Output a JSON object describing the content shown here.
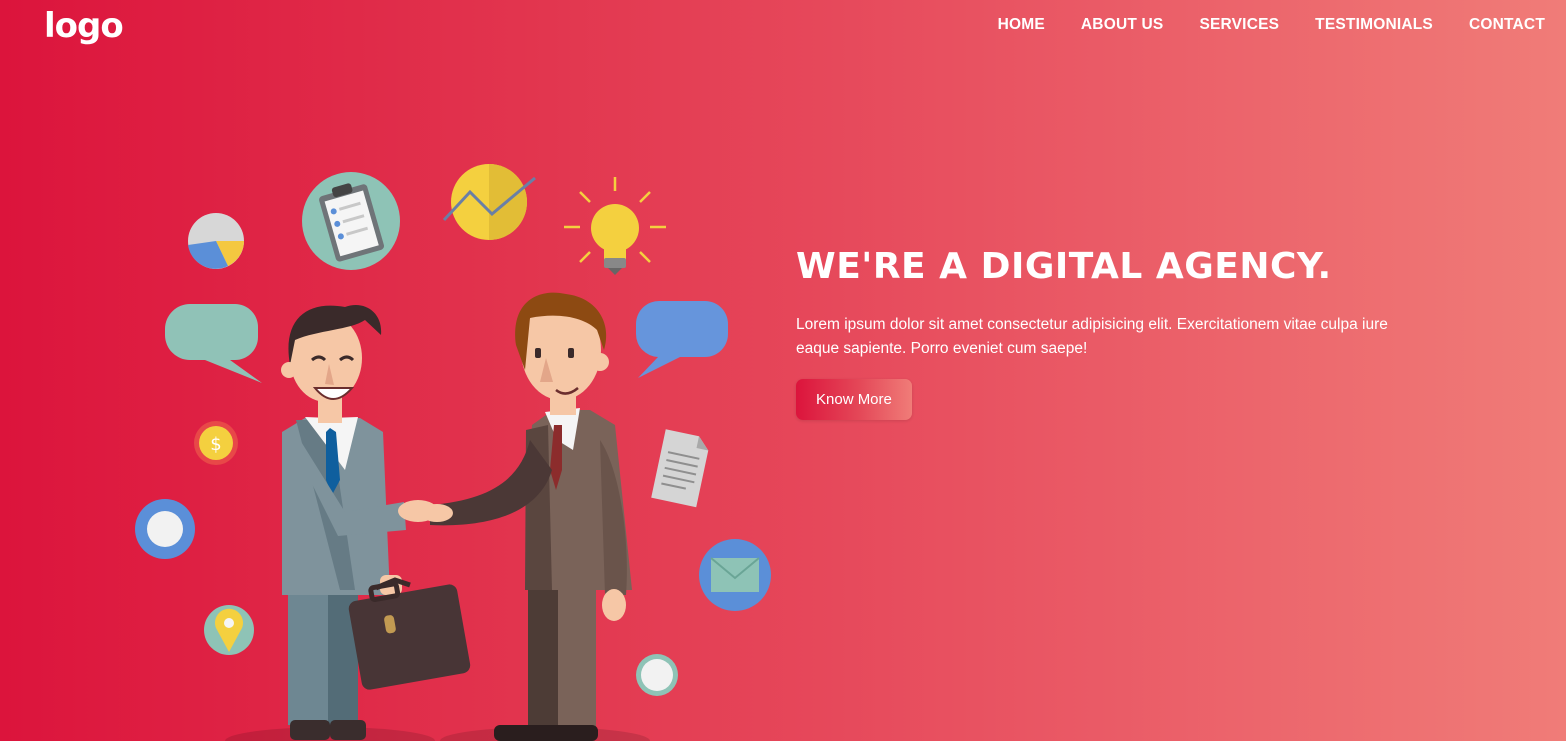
{
  "brand": {
    "logo_text": "logo"
  },
  "nav": {
    "items": [
      {
        "label": "HOME"
      },
      {
        "label": "ABOUT US"
      },
      {
        "label": "SERVICES"
      },
      {
        "label": "TESTIMONIALS"
      },
      {
        "label": "CONTACT"
      }
    ]
  },
  "hero": {
    "title": "WE'RE A DIGITAL AGENCY.",
    "description": "Lorem ipsum dolor sit amet consectetur adipisicing elit. Exercitationem vitae culpa iure eaque sapiente. Porro eveniet cum saepe!",
    "cta_label": "Know More",
    "illustration": {
      "icons": [
        "pie-chart-icon",
        "clipboard-icon",
        "line-chart-icon",
        "lightbulb-icon",
        "chat-bubble-icon",
        "coin-icon",
        "document-icon",
        "envelope-icon",
        "location-pin-icon"
      ]
    }
  },
  "colors": {
    "gradient_start": "#dc143c",
    "gradient_end": "#f07c78",
    "text": "#ffffff"
  }
}
